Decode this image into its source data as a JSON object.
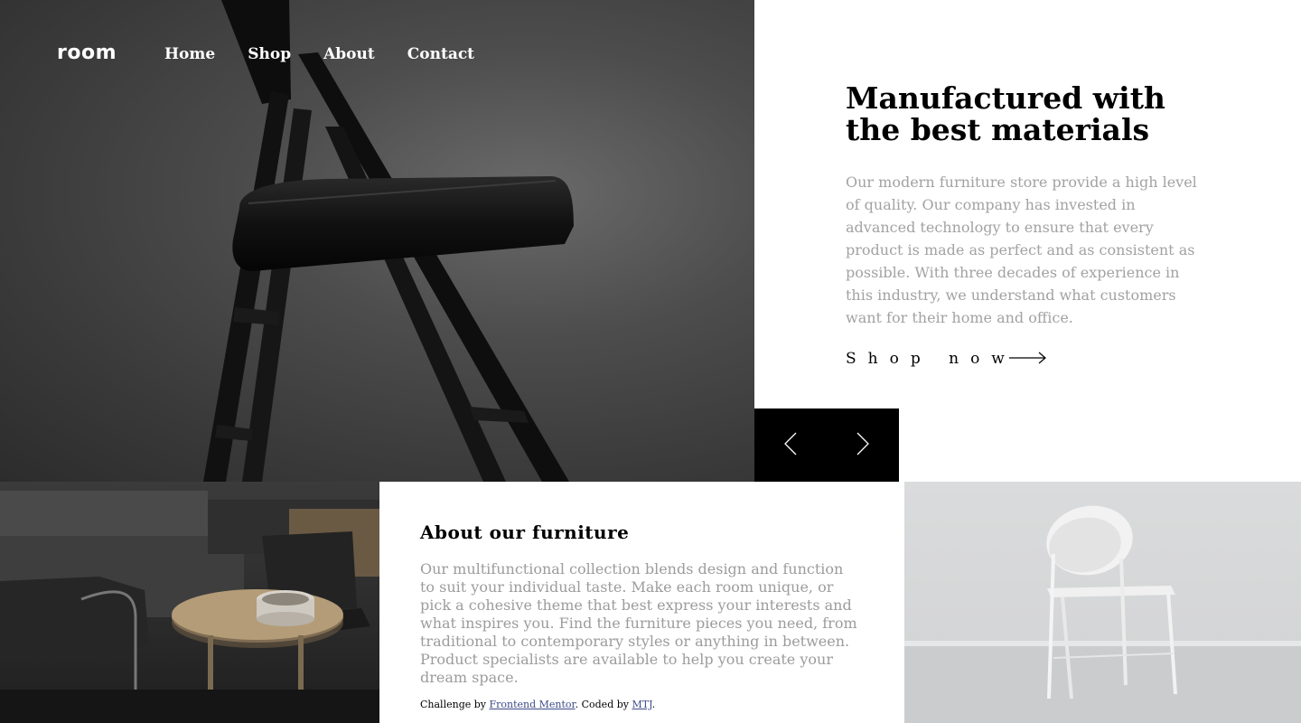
{
  "brand": {
    "logo": "room"
  },
  "nav": {
    "items": [
      {
        "label": "Home"
      },
      {
        "label": "Shop"
      },
      {
        "label": "About"
      },
      {
        "label": "Contact"
      }
    ]
  },
  "hero": {
    "title": "Manufactured with the best materials",
    "description": "Our modern furniture store provide a high level of quality. Our company has invested in advanced technology to ensure that every product is made as perfect and as consistent as possible. With three decades of experience in this industry, we understand what customers want for their home and office.",
    "cta_label": "Shop now",
    "image_icon": "folding-chair-photo"
  },
  "slider": {
    "prev_icon": "chevron-left-icon",
    "next_icon": "chevron-right-icon"
  },
  "about": {
    "title": "About our furniture",
    "description": "Our multifunctional collection blends design and function to suit your individual taste. Make each room unique, or pick a cohesive theme that best express your interests and what inspires you. Find the furniture pieces you need, from traditional to contemporary styles or anything in between. Product specialists are available to help you create your dream space."
  },
  "attribution": {
    "prefix": "Challenge by ",
    "challenge_link": "Frontend Mentor",
    "middle": ". Coded by ",
    "author_link": "MTJ",
    "suffix": "."
  },
  "colors": {
    "accent": "#000000",
    "muted_text": "#a2a2a2",
    "link": "#3d4b8a"
  }
}
